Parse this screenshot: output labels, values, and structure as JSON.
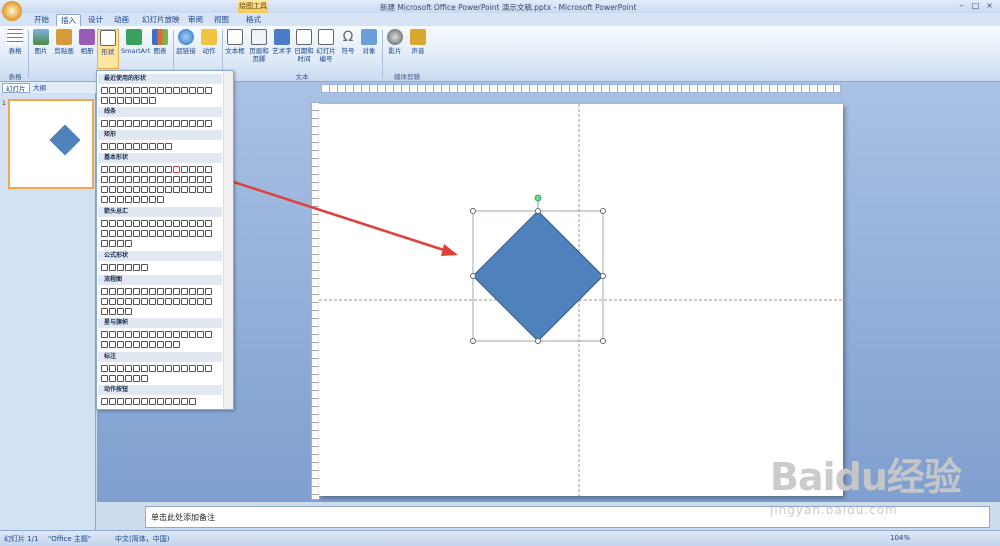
{
  "window": {
    "title": "新建 Microsoft Office PowerPoint 演示文稿.pptx - Microsoft PowerPoint",
    "context_tool": "绘图工具",
    "controls": [
      "–",
      "□",
      "×"
    ]
  },
  "tabs": [
    {
      "label": "开始"
    },
    {
      "label": "插入",
      "active": true
    },
    {
      "label": "设计"
    },
    {
      "label": "动画"
    },
    {
      "label": "幻灯片放映"
    },
    {
      "label": "审阅"
    },
    {
      "label": "视图"
    },
    {
      "label": "格式"
    }
  ],
  "ribbon": {
    "buttons": [
      "表格",
      "图片",
      "剪贴画",
      "相册",
      "形状",
      "SmartArt",
      "图表",
      "超链接",
      "动作",
      "文本框",
      "页眉和页脚",
      "艺术字",
      "日期和时间",
      "幻灯片编号",
      "符号",
      "对象",
      "影片",
      "声音"
    ],
    "groups": [
      "表格",
      "文本",
      "媒体剪辑"
    ]
  },
  "left_pane": {
    "tabs": [
      "幻灯片",
      "大纲"
    ],
    "slide_number": "1"
  },
  "shapes_menu": {
    "sections": [
      "最近使用的形状",
      "线条",
      "矩形",
      "基本形状",
      "箭头总汇",
      "公式形状",
      "流程图",
      "星与旗帜",
      "标注",
      "动作按钮"
    ]
  },
  "notes": {
    "placeholder": "单击此处添加备注"
  },
  "status": {
    "slide": "幻灯片 1/1",
    "theme": "\"Office 主题\"",
    "language": "中文(简体，中国)",
    "zoom": "104%"
  },
  "watermark": {
    "brand": "Baidu经验",
    "url": "jingyan.baidu.com"
  },
  "colors": {
    "diamond_fill": "#4f81bd",
    "diamond_stroke": "#385d8a",
    "arrow": "#e0403a",
    "accent": "#f3a64a"
  }
}
